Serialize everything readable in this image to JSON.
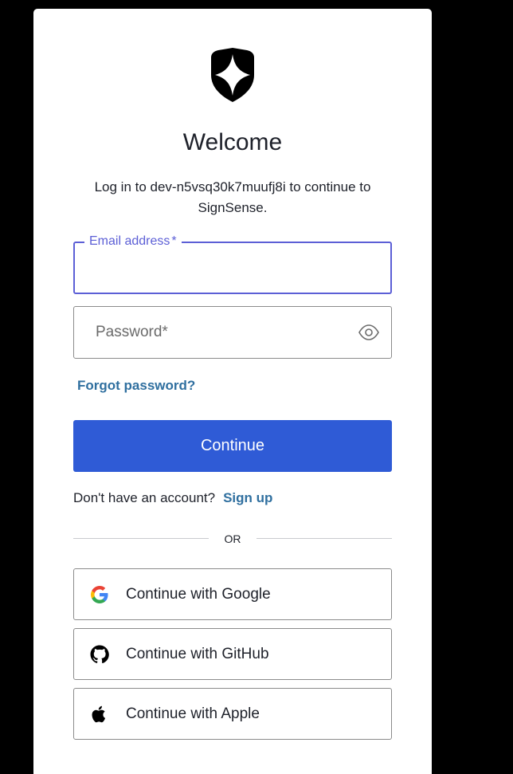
{
  "header": {
    "logo_icon": "shield-star-icon",
    "title": "Welcome",
    "subtitle_line1": "Log in to dev-n5vsq30k7muufj8i to continue to",
    "subtitle_line2": "SignSense."
  },
  "form": {
    "email_label": "Email address",
    "email_required_mark": "*",
    "email_value": "",
    "password_label": "Password",
    "password_required_mark": "*",
    "password_value": "",
    "show_password_icon": "eye-icon",
    "forgot_password": "Forgot password?",
    "continue_label": "Continue"
  },
  "signup": {
    "prompt": "Don't have an account?",
    "link": "Sign up"
  },
  "divider": {
    "text": "OR"
  },
  "social": [
    {
      "label": "Continue with Google",
      "icon": "google-icon"
    },
    {
      "label": "Continue with GitHub",
      "icon": "github-icon"
    },
    {
      "label": "Continue with Apple",
      "icon": "apple-icon"
    }
  ],
  "colors": {
    "page_background": "#000000",
    "card_background": "#ffffff",
    "accent_focus": "#5c5fd6",
    "primary_button": "#2f5bd6",
    "link": "#2f6f9f",
    "text": "#1e212a"
  }
}
